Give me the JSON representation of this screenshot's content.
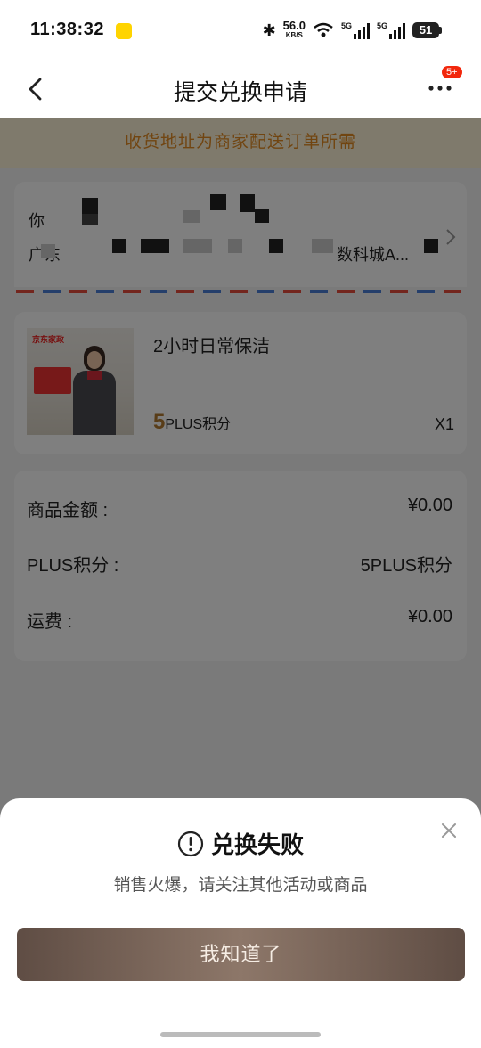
{
  "status_bar": {
    "time": "11:38:32",
    "net_speed": "56.0",
    "net_unit": "KB/S",
    "sim1": "5G",
    "sim2": "5G",
    "battery": "51"
  },
  "nav": {
    "title": "提交兑换申请",
    "badge": "5+"
  },
  "notice": "收货地址为商家配送订单所需",
  "address": {
    "name_prefix": "你",
    "address_prefix": "广东",
    "address_suffix": "数科城A..."
  },
  "product": {
    "name": "2小时日常保洁",
    "image_logo": "京东家政",
    "points_value": "5",
    "points_unit": "PLUS积分",
    "quantity": "X1"
  },
  "price": {
    "rows": [
      {
        "label": "商品金额 :",
        "value": "¥0.00"
      },
      {
        "label": "PLUS积分 :",
        "value": "5PLUS积分"
      },
      {
        "label": "运费 :",
        "value": "¥0.00"
      }
    ]
  },
  "dialog": {
    "title": "兑换失败",
    "message": "销售火爆，请关注其他活动或商品",
    "button": "我知道了"
  },
  "colors": {
    "accent": "#e38b22",
    "badge": "#f2270c",
    "points": "#b37a30",
    "button": "#6e5b50"
  }
}
